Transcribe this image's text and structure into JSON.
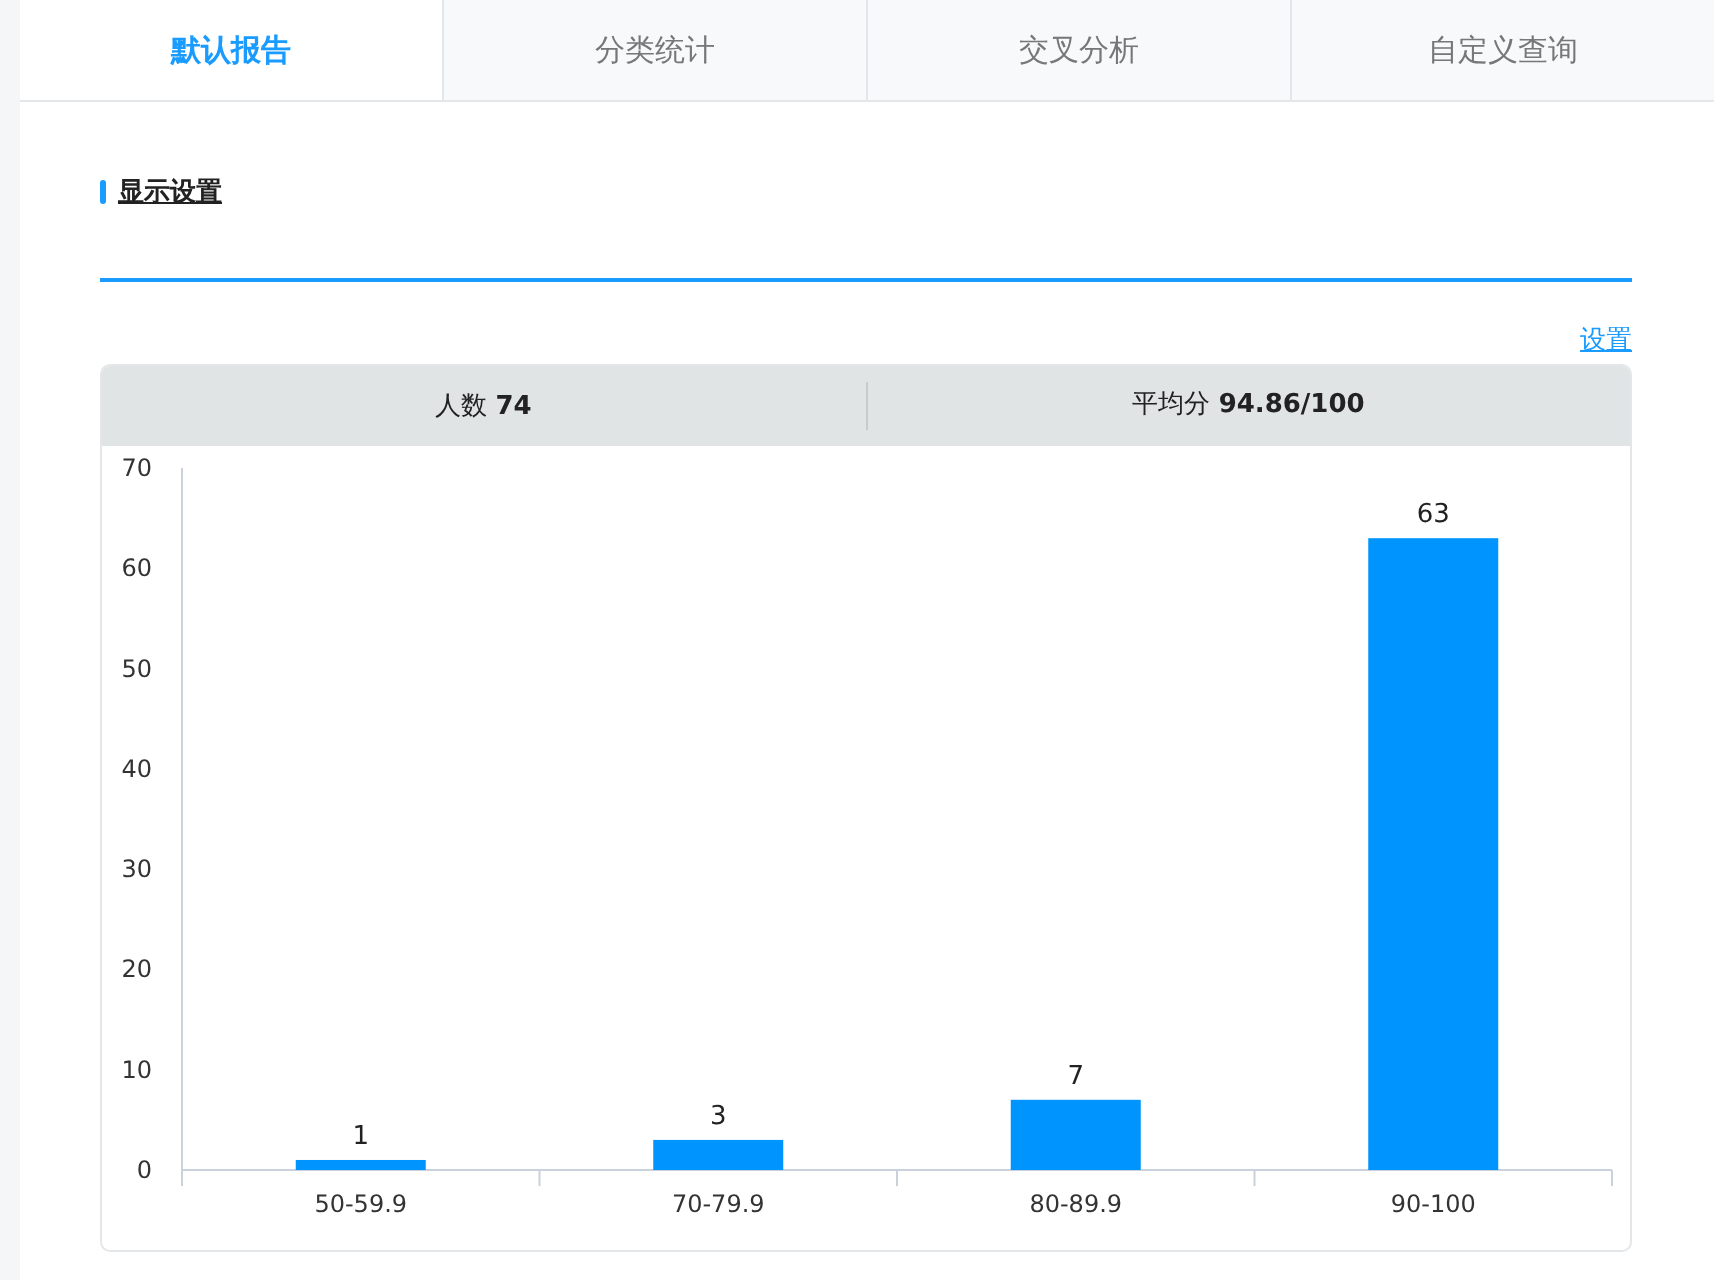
{
  "tabs": [
    {
      "label": "默认报告",
      "selected": true
    },
    {
      "label": "分类统计",
      "selected": false
    },
    {
      "label": "交叉分析",
      "selected": false
    },
    {
      "label": "自定义查询",
      "selected": false
    }
  ],
  "section_title": "显示设置",
  "settings_link": "设置",
  "stats": [
    "人数 **74**",
    "平均分 **94.86/100**"
  ],
  "chart_data": {
    "type": "bar",
    "categories": [
      "50-59.9",
      "70-79.9",
      "80-89.9",
      "90-100"
    ],
    "series": [
      {
        "color": "#0094ff",
        "values": [
          1,
          3,
          7,
          63
        ]
      }
    ],
    "ylim": [
      0,
      70
    ],
    "yticks": [
      0,
      10,
      20,
      30,
      40,
      50,
      60,
      70
    ],
    "data_labels": true
  }
}
